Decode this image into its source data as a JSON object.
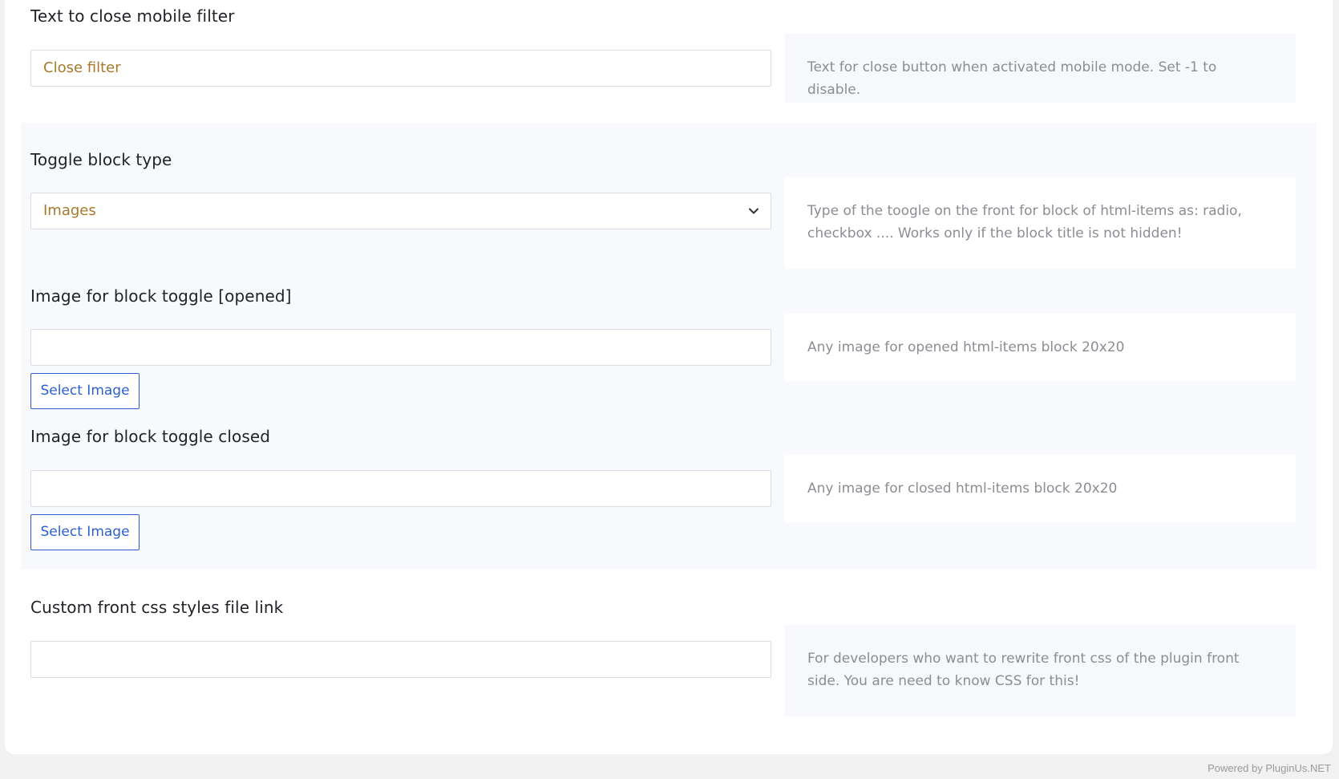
{
  "settings": {
    "close_filter": {
      "label": "Text to close mobile filter",
      "value": "Close filter",
      "description": "Text for close button when activated mobile mode. Set -1 to disable."
    },
    "toggle_type": {
      "label": "Toggle block type",
      "selected": "Images",
      "description": "Type of the toogle on the front for block of html-items as: radio, checkbox .... Works only if the block title is not hidden!"
    },
    "toggle_opened": {
      "label": "Image for block toggle [opened]",
      "value": "",
      "button_label": "Select Image",
      "description": "Any image for opened html-items block 20x20"
    },
    "toggle_closed": {
      "label": "Image for block toggle closed",
      "value": "",
      "button_label": "Select Image",
      "description": "Any image for closed html-items block 20x20"
    },
    "custom_css": {
      "label": "Custom front css styles file link",
      "value": "",
      "description": "For developers who want to rewrite front css of the plugin front side. You are need to know CSS for this!"
    }
  },
  "footer": {
    "powered_by": "Powered by PluginUs.NET"
  },
  "colors": {
    "accent": "#2c5fce",
    "input_text": "#a8792b",
    "description_text": "#8a8d93"
  }
}
